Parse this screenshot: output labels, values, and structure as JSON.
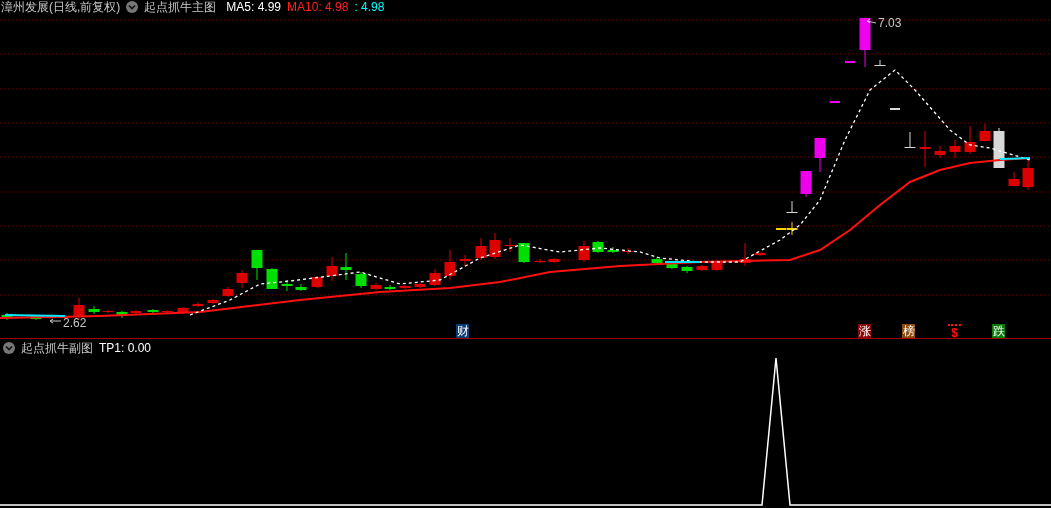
{
  "main_chart": {
    "title": "漳州发展(日线,前复权)",
    "indicator": "起点抓牛主图",
    "values": [
      {
        "label": "MA5: 4.99",
        "color": "#ffffff"
      },
      {
        "label": "MA10: 4.98",
        "color": "#ff2020"
      },
      {
        "label": ": 4.98",
        "color": "#00ffff"
      }
    ],
    "high_label": "7.03",
    "low_label": "2.62",
    "markers": [
      {
        "text": "财",
        "kind": "badge",
        "color": "#0b3c73"
      },
      {
        "text": "涨",
        "kind": "badge",
        "color": "#8a0a0a"
      },
      {
        "text": "榜",
        "kind": "badge",
        "color": "#8a4a10"
      },
      {
        "text": "$",
        "kind": "signal",
        "color": "#ff1010"
      },
      {
        "text": "跌",
        "kind": "badge",
        "color": "#0a7a0a"
      }
    ]
  },
  "sub_chart": {
    "indicator": "起点抓牛副图",
    "values": [
      {
        "label": "TP1: 0.00",
        "color": "#ffffff"
      }
    ]
  }
}
